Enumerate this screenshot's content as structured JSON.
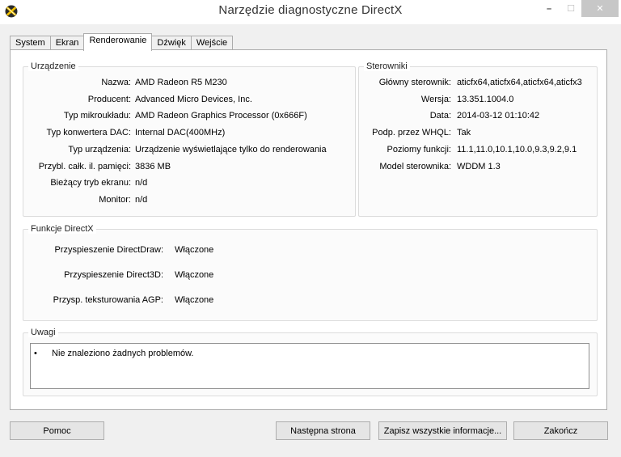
{
  "window": {
    "title": "Narzędzie diagnostyczne DirectX",
    "minimize_glyph": "–",
    "maximize_glyph": "☐",
    "close_glyph": "✕"
  },
  "tabs": [
    {
      "label": "System"
    },
    {
      "label": "Ekran"
    },
    {
      "label": "Renderowanie",
      "active": true
    },
    {
      "label": "Dźwięk"
    },
    {
      "label": "Wejście"
    }
  ],
  "device": {
    "label": "Urządzenie",
    "rows": [
      {
        "key": "Nazwa:",
        "value": "AMD Radeon R5 M230"
      },
      {
        "key": "Producent:",
        "value": "Advanced Micro Devices, Inc."
      },
      {
        "key": "Typ mikroukładu:",
        "value": "AMD Radeon Graphics Processor (0x666F)"
      },
      {
        "key": "Typ konwertera DAC:",
        "value": "Internal DAC(400MHz)"
      },
      {
        "key": "Typ urządzenia:",
        "value": "Urządzenie wyświetlające tylko do renderowania"
      },
      {
        "key": "Przybl. całk. il. pamięci:",
        "value": "3836 MB"
      },
      {
        "key": "Bieżący tryb ekranu:",
        "value": "n/d"
      },
      {
        "key": "Monitor:",
        "value": "n/d"
      }
    ]
  },
  "drivers": {
    "label": "Sterowniki",
    "rows": [
      {
        "key": "Główny sterownik:",
        "value": "aticfx64,aticfx64,aticfx64,aticfx3"
      },
      {
        "key": "Wersja:",
        "value": "13.351.1004.0"
      },
      {
        "key": "Data:",
        "value": "2014-03-12 01:10:42"
      },
      {
        "key": "Podp. przez WHQL:",
        "value": "Tak"
      },
      {
        "key": "Poziomy funkcji:",
        "value": "11.1,11.0,10.1,10.0,9.3,9.2,9.1"
      },
      {
        "key": "Model sterownika:",
        "value": "WDDM 1.3"
      }
    ]
  },
  "directx": {
    "label": "Funkcje DirectX",
    "rows": [
      {
        "key": "Przyspieszenie DirectDraw:",
        "value": "Włączone"
      },
      {
        "key": "Przyspieszenie Direct3D:",
        "value": "Włączone"
      },
      {
        "key": "Przysp. teksturowania AGP:",
        "value": "Włączone"
      }
    ]
  },
  "notes": {
    "label": "Uwagi",
    "bullet": "•",
    "text": "Nie znaleziono żadnych problemów."
  },
  "buttons": {
    "help": "Pomoc",
    "next_page": "Następna strona",
    "save_all": "Zapisz wszystkie informacje...",
    "exit": "Zakończ"
  },
  "colors": {
    "window_bg": "#f0f0f0",
    "page_bg": "#ffffff",
    "border": "#acacac",
    "button_bg": "#e5e5e5",
    "close_bg": "#c7c7c7"
  }
}
